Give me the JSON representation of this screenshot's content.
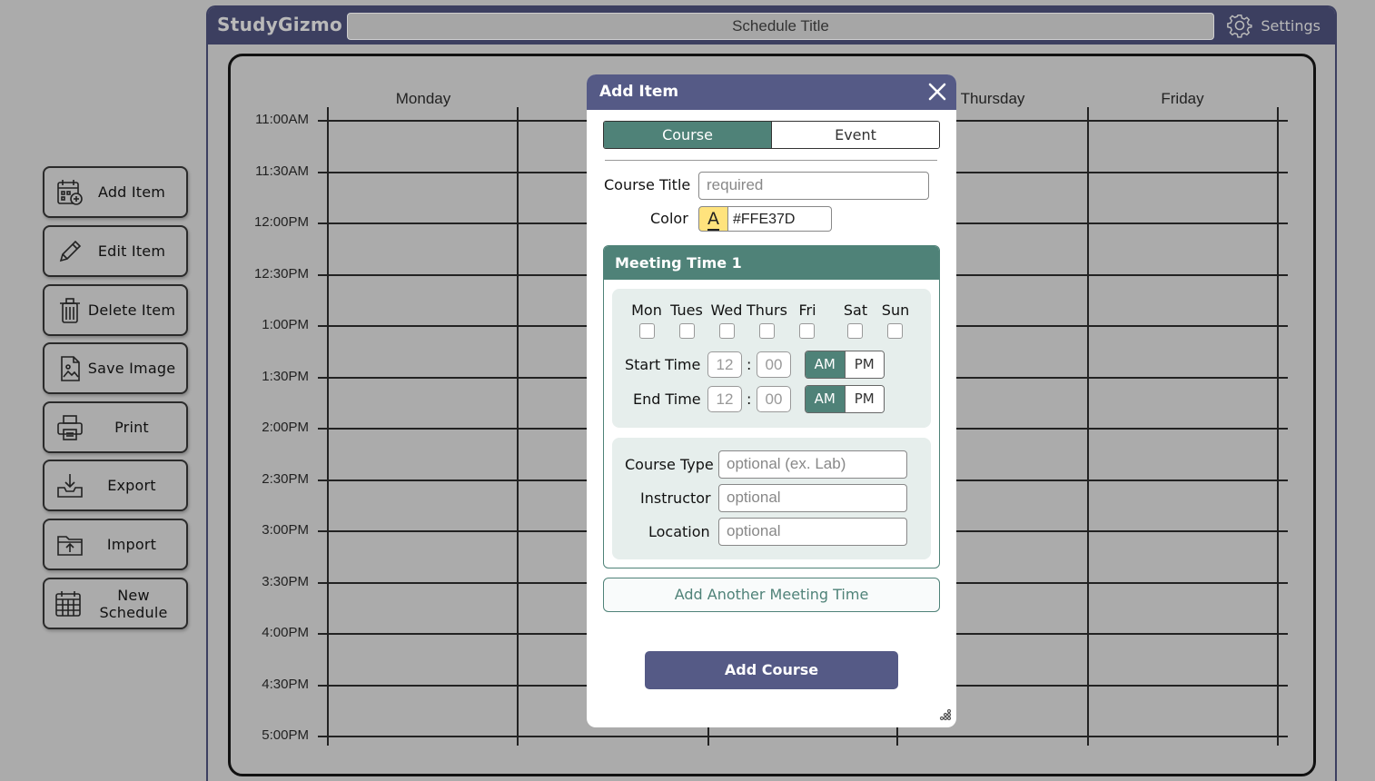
{
  "sidebar": {
    "items": [
      {
        "label": "Add Item",
        "icon": "calendar-add-icon"
      },
      {
        "label": "Edit Item",
        "icon": "pencil-icon"
      },
      {
        "label": "Delete Item",
        "icon": "trash-icon"
      },
      {
        "label": "Save Image",
        "icon": "image-file-icon"
      },
      {
        "label": "Print",
        "icon": "printer-icon"
      },
      {
        "label": "Export",
        "icon": "export-tray-icon"
      },
      {
        "label": "Import",
        "icon": "import-folder-icon"
      },
      {
        "label": "New Schedule",
        "icon": "calendar-grid-icon"
      }
    ]
  },
  "header": {
    "logo": "StudyGizmo",
    "title_placeholder": "Schedule Title",
    "settings_label": "Settings"
  },
  "schedule": {
    "days": [
      "Monday",
      "Thursday",
      "Friday"
    ],
    "times": [
      "11:00AM",
      "11:30AM",
      "12:00PM",
      "12:30PM",
      "1:00PM",
      "1:30PM",
      "2:00PM",
      "2:30PM",
      "3:00PM",
      "3:30PM",
      "4:00PM",
      "4:30PM",
      "5:00PM"
    ]
  },
  "modal": {
    "title": "Add Item",
    "tabs": {
      "course": "Course",
      "event": "Event"
    },
    "course_title_label": "Course Title",
    "course_title_placeholder": "required",
    "color_label": "Color",
    "color_swatch_letter": "A",
    "color_value": "#FFE37D",
    "meeting": {
      "title": "Meeting Time 1",
      "days": [
        "Mon",
        "Tues",
        "Wed",
        "Thurs",
        "Fri",
        "Sat",
        "Sun"
      ],
      "start_label": "Start Time",
      "end_label": "End Time",
      "hour_placeholder": "12",
      "minute_placeholder": "00",
      "colon": ":",
      "am": "AM",
      "pm": "PM",
      "course_type_label": "Course Type",
      "course_type_placeholder": "optional (ex. Lab)",
      "instructor_label": "Instructor",
      "instructor_placeholder": "optional",
      "location_label": "Location",
      "location_placeholder": "optional"
    },
    "add_meeting_label": "Add Another Meeting Time",
    "submit_label": "Add Course"
  },
  "colors": {
    "header": "#3c3f60",
    "modal_header": "#555a86",
    "accent_green": "#4f8278",
    "swatch": "#FFE37D",
    "overlay_bg": "#ababab"
  }
}
